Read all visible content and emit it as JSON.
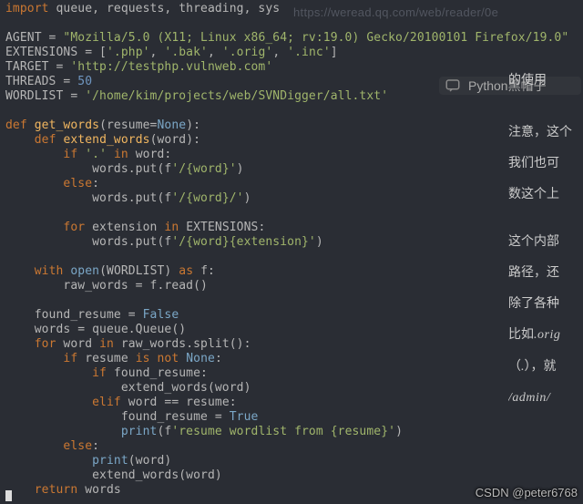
{
  "code": {
    "import_kw": "import",
    "import_mods": " queue, requests, threading, sys",
    "agent_eq": "AGENT = ",
    "agent_val": "\"Mozilla/5.0 (X11; Linux x86_64; rv:19.0) Gecko/20100101 Firefox/19.0\"",
    "ext_pre": "EXTENSIONS = [",
    "ext1": "'.php'",
    "ext2": "'.bak'",
    "ext3": "'.orig'",
    "ext4": "'.inc'",
    "ext_close": "]",
    "target_pre": "TARGET = ",
    "target_val": "'http://testphp.vulnweb.com'",
    "threads_pre": "THREADS = ",
    "threads_val": "50",
    "wordlist_pre": "WORDLIST = ",
    "wordlist_val": "'/home/kim/projects/web/SVNDigger/all.txt'",
    "def_kw": "def",
    "getwords": "get_words",
    "getwords_sig_a": "(resume=",
    "none": "None",
    "getwords_sig_b": "):",
    "extendwords": "extend_words",
    "extendwords_sig": "(word):",
    "if_kw": "if",
    "dot_str": "'.'",
    "in_kw": "in",
    "word_colon": " word:",
    "putsf_a": "            words.put(f",
    "fstr1": "'/{word}'",
    "close_paren": ")",
    "else_kw": "else",
    "colon": ":",
    "putsf_b": "            words.put(f",
    "fstr2": "'/{word}/'",
    "for_kw": "for",
    "ext_loop": " extension ",
    "ext_tail": " EXTENSIONS:",
    "putsf_c": "            words.put(f",
    "fstr3": "'/{word}{extension}'",
    "with_kw": "with",
    "open_kw": "open",
    "open_args": "(WORDLIST) ",
    "as_kw": "as",
    "as_f": " f:",
    "rawread": "        raw_words = f.read()",
    "found_pre": "    found_resume = ",
    "false": "False",
    "queue_line": "    words = queue.Queue()",
    "for2_mid": " word ",
    "for2_tail": " raw_words.split():",
    "resume_mid": " resume ",
    "is_kw": "is",
    "not_kw": "not",
    "found_if": " found_resume:",
    "ew_call1": "                extend_words(word)",
    "elif_kw": "elif",
    "elif_cond": " word == resume:",
    "found_set": "                found_resume = ",
    "true": "True",
    "print_kw": "print",
    "print_open": "(f",
    "print_str": "'resume wordlist from {resume}'",
    "print_word": "(word)",
    "ew_call2": "            extend_words(word)",
    "return_kw": "return",
    "return_tail": " words"
  },
  "sidebar": {
    "note_inside_line": "的使用",
    "note1": "注意，这个",
    "note2": "我们也可",
    "note3": "数这个上",
    "note4": "这个内部",
    "note5": "路径，还",
    "note6": "除了各种",
    "note7_pre": "比如",
    "note7_it": ".orig",
    "note8_a": "（",
    "note8_dot": ".",
    "note8_b": "），就",
    "note9": "/admin/",
    "banner": "Python黑帽子",
    "banner2_tail": ""
  },
  "top_url": "https://weread.qq.com/web/reader/0e",
  "watermark": "CSDN @peter6768"
}
